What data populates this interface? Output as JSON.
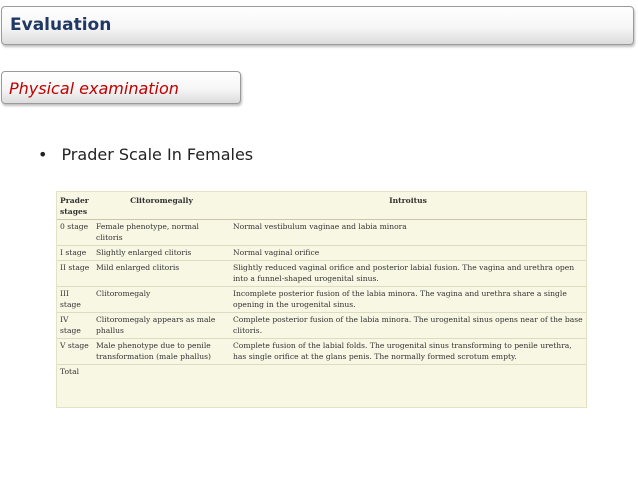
{
  "header": {
    "title": "Evaluation"
  },
  "section": {
    "title": "Physical examination"
  },
  "bullet": {
    "symbol": "•",
    "text": "Prader Scale In Females"
  },
  "table": {
    "columns": [
      "Prader stages",
      "Clitoromegally",
      "Introitus"
    ],
    "rows": [
      [
        "0 stage",
        "Female phenotype, normal clitoris",
        "Normal vestibulum vaginae and labia minora"
      ],
      [
        "I stage",
        "Slightly enlarged clitoris",
        "Normal vaginal orifice"
      ],
      [
        "II stage",
        "Mild enlarged clitoris",
        "Slightly reduced vaginal orifice and posterior labial fusion. The vagina and urethra open into a funnel-shaped urogenital sinus."
      ],
      [
        "III stage",
        "Clitoromegaly",
        "Incomplete posterior fusion of the labia minora. The vagina and urethra share a single opening in the urogenital sinus."
      ],
      [
        "IV stage",
        "Clitoromegaly appears as male phallus",
        "Complete posterior fusion of the labia minora. The urogenital sinus opens near of the base clitoris."
      ],
      [
        "V stage",
        "Male phenotype due to penile transformation (male phallus)",
        "Complete fusion of the labial folds. The urogenital sinus transforming to penile urethra, has single orifice at the glans penis. The normally formed scrotum empty."
      ],
      [
        "Total",
        "",
        ""
      ]
    ]
  },
  "colors": {
    "header_text": "#1f3864",
    "section_text": "#c00000",
    "table_bg": "#f8f7e4"
  }
}
